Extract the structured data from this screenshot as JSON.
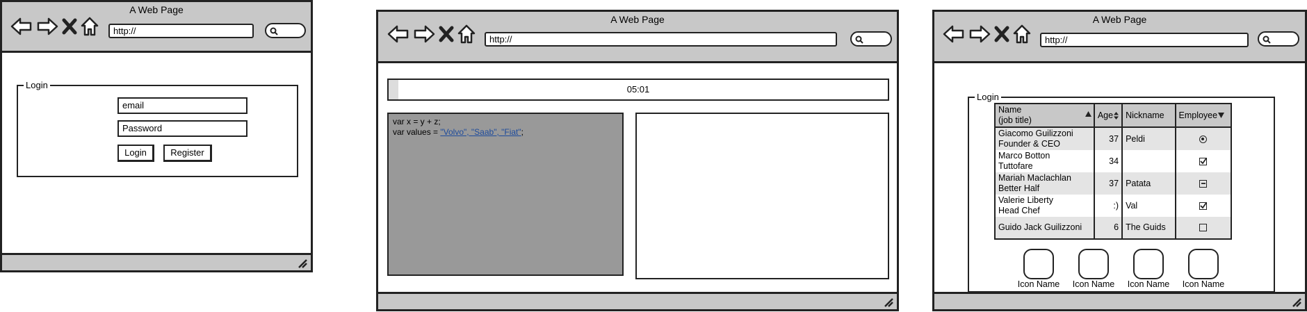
{
  "windows": [
    {
      "title": "A Web Page",
      "url": "http://",
      "login": {
        "legend": "Login",
        "email_value": "email",
        "password_value": "Password",
        "login_label": "Login",
        "register_label": "Register"
      }
    },
    {
      "title": "A Web Page",
      "url": "http://",
      "progress": {
        "text": "05:01",
        "fraction": 0.02
      },
      "code": {
        "line1": "var x = y + z;",
        "line2_prefix": "var values = ",
        "line2_link": "\"Volvo\", \"Saab\", \"Fiat\"",
        "line2_suffix": ";"
      }
    },
    {
      "title": "A Web Page",
      "url": "http://",
      "group_legend": "Login",
      "table": {
        "headers": {
          "name_line1": "Name",
          "name_line2": "(job title)",
          "age": "Age",
          "nickname": "Nickname",
          "employee": "Employee"
        },
        "rows": [
          {
            "name": "Giacomo Guilizzoni",
            "title": "Founder & CEO",
            "age": "37",
            "nickname": "Peldi",
            "employee": "radio-selected"
          },
          {
            "name": "Marco Botton",
            "title": "Tuttofare",
            "age": "34",
            "nickname": "",
            "employee": "checked"
          },
          {
            "name": "Mariah Maclachlan",
            "title": "Better Half",
            "age": "37",
            "nickname": "Patata",
            "employee": "indeterminate"
          },
          {
            "name": "Valerie Liberty",
            "title": "Head Chef",
            "age": ":)",
            "nickname": "Val",
            "employee": "checked"
          },
          {
            "name": "Guido Jack Guilizzoni",
            "title": "",
            "age": "6",
            "nickname": "The Guids",
            "employee": "unchecked"
          }
        ]
      },
      "icons": [
        {
          "label": "Icon Name"
        },
        {
          "label": "Icon Name"
        },
        {
          "label": "Icon Name"
        },
        {
          "label": "Icon Name"
        }
      ]
    }
  ]
}
